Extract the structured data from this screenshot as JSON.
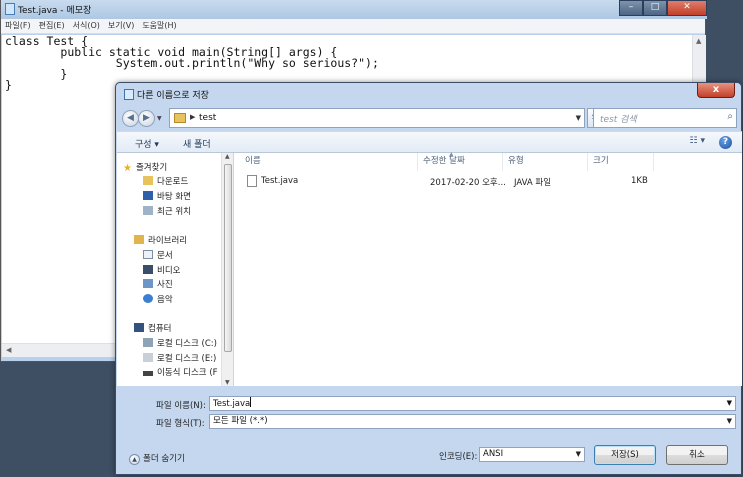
{
  "notepad": {
    "title": "Test.java - 메모장",
    "minimize": "–",
    "maximize": "□",
    "close": "✕",
    "menu": [
      "파일(F)",
      "편집(E)",
      "서식(O)",
      "보기(V)",
      "도움말(H)"
    ],
    "code": "class Test {\n\tpublic static void main(String[] args) {\n\t\tSystem.out.println(\"Why so serious?\");\n\t}\n}"
  },
  "dialog": {
    "title": "다른 이름으로 저장",
    "close": "x",
    "address_path": "test",
    "search_placeholder": "test 검색",
    "toolbar": {
      "organize": "구성 ▾",
      "new_folder": "새 폴더",
      "view": "☷ ▾",
      "help": "?"
    },
    "nav": {
      "favorites": "즐겨찾기",
      "downloads": "다운로드",
      "desktop": "바탕 화면",
      "recent": "최근 위치",
      "libraries": "라이브러리",
      "documents": "문서",
      "videos": "비디오",
      "pictures": "사진",
      "music": "음악",
      "computer": "컴퓨터",
      "local_c": "로컬 디스크 (C:)",
      "local_e": "로컬 디스크 (E:)",
      "removable": "이동식 디스크 (F"
    },
    "columns": {
      "name": "이름",
      "modified": "수정한 날짜",
      "type": "유형",
      "size": "크기"
    },
    "files": [
      {
        "name": "Test.java",
        "modified": "2017-02-20 오후...",
        "type": "JAVA 파일",
        "size": "1KB"
      }
    ],
    "filename_label": "파일 이름(N):",
    "filename_value": "Test.java",
    "filetype_label": "파일 형식(T):",
    "filetype_value": "모든 파일 (*.*)",
    "encoding_label": "인코딩(E):",
    "encoding_value": "ANSI",
    "hide_folders": "폴더 숨기기",
    "save_button": "저장(S)",
    "cancel_button": "취소"
  }
}
